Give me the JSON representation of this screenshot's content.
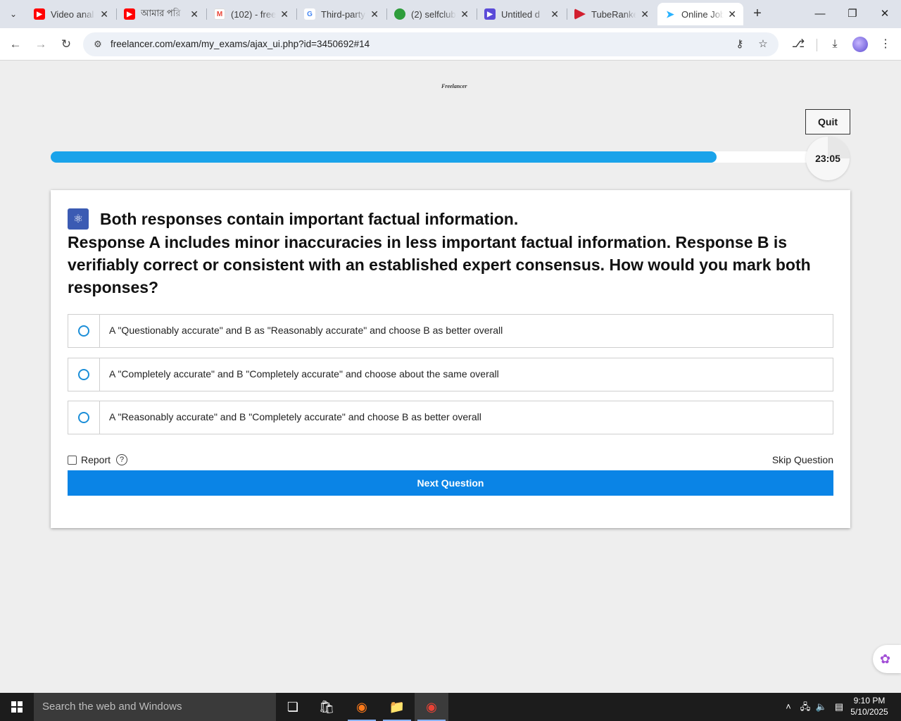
{
  "browser": {
    "tabs": [
      {
        "title": "Video anal",
        "icon": "youtube-icon",
        "color": "#ff0000"
      },
      {
        "title": "আমার পরি",
        "icon": "youtube-icon",
        "color": "#ff0000"
      },
      {
        "title": "(102) - free",
        "icon": "gmail-icon",
        "color": "#ea4335"
      },
      {
        "title": "Third-party",
        "icon": "google-icon",
        "color": "#4285f4"
      },
      {
        "title": "(2) selfclub",
        "icon": "selfclub-icon",
        "color": "#2e9d3b"
      },
      {
        "title": "Untitled d",
        "icon": "video-editor-icon",
        "color": "#5b4bd8"
      },
      {
        "title": "TubeRanke",
        "icon": "tuberanker-icon",
        "color": "#d21f2f"
      },
      {
        "title": "Online Job",
        "icon": "freelancer-icon",
        "color": "#29b2fe",
        "active": true
      }
    ],
    "url": "freelancer.com/exam/my_exams/ajax_ui.php?id=3450692#14"
  },
  "exam": {
    "logo": "Freelancer",
    "quit_label": "Quit",
    "progress": 0.86,
    "timer": "23:05",
    "question_title": "Both responses contain important factual information.",
    "question_body": "Response A includes minor inaccuracies in less important factual information. Response B is verifiably correct or consistent with an established expert consensus. How would you mark both responses?",
    "options": [
      "A \"Questionably accurate\" and B as \"Reasonably accurate\" and choose B as better overall",
      "A \"Completely accurate\" and B \"Completely accurate\" and choose about the same overall",
      "A \"Reasonably accurate\" and B \"Completely accurate\" and choose B as better overall"
    ],
    "report_label": "Report",
    "help_label": "?",
    "skip_label": "Skip Question",
    "next_label": "Next Question"
  },
  "taskbar": {
    "search_placeholder": "Search the web and Windows",
    "time": "9:10 PM",
    "date": "5/10/2025"
  },
  "colors": {
    "accent": "#0a84e6",
    "progress": "#1aa3ea"
  }
}
